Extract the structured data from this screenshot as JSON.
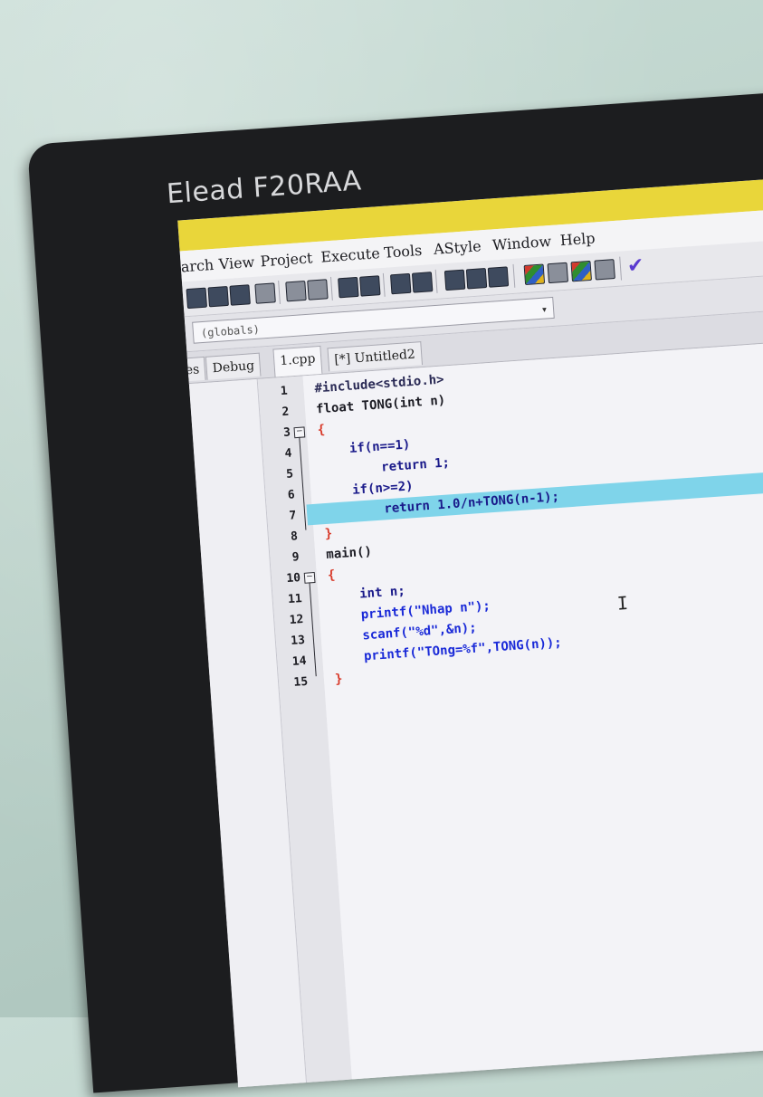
{
  "monitor": {
    "brand": "Elead F20RAA"
  },
  "menu": {
    "items": [
      "arch",
      "View",
      "Project",
      "Execute",
      "Tools",
      "AStyle",
      "Window",
      "Help"
    ]
  },
  "toolbar": {
    "icons": [
      "new-file-icon",
      "open-icon",
      "save-icon",
      "print-icon",
      "undo-icon",
      "redo-icon",
      "find-icon",
      "replace-icon",
      "goto-icon",
      "bookmark-icon",
      "compile-icon",
      "run-icon",
      "compile-run-icon",
      "debug-icon",
      "class-icon",
      "window-icon",
      "color-grid-icon",
      "layout-icon",
      "check-icon"
    ]
  },
  "combo": {
    "value": "(globals)"
  },
  "tabs": {
    "left": [
      "es",
      "Debug"
    ],
    "files": [
      "1.cpp",
      "[*] Untitled2"
    ],
    "active_file": "1.cpp"
  },
  "editor": {
    "line_numbers": [
      "1",
      "2",
      "3",
      "4",
      "5",
      "6",
      "7",
      "8",
      "9",
      "10",
      "11",
      "12",
      "13",
      "14",
      "15"
    ],
    "highlighted_line": 7,
    "lines": [
      "#include<stdio.h>",
      "float TONG(int n)",
      "{",
      "    if(n==1)",
      "        return 1;",
      "    if(n>=2)",
      "        return 1.0/n+TONG(n-1);",
      "}",
      "main()",
      "{",
      "    int n;",
      "    printf(\"Nhap n\");",
      "    scanf(\"%d\",&n);",
      "    printf(\"TOng=%f\",TONG(n));",
      "}"
    ]
  },
  "colors": {
    "bezel": "#1c1d1f",
    "titlebar": "#e9d63a",
    "highlight": "#7fd4ea",
    "string": "#1a2ad8",
    "brace": "#d83a2a"
  }
}
